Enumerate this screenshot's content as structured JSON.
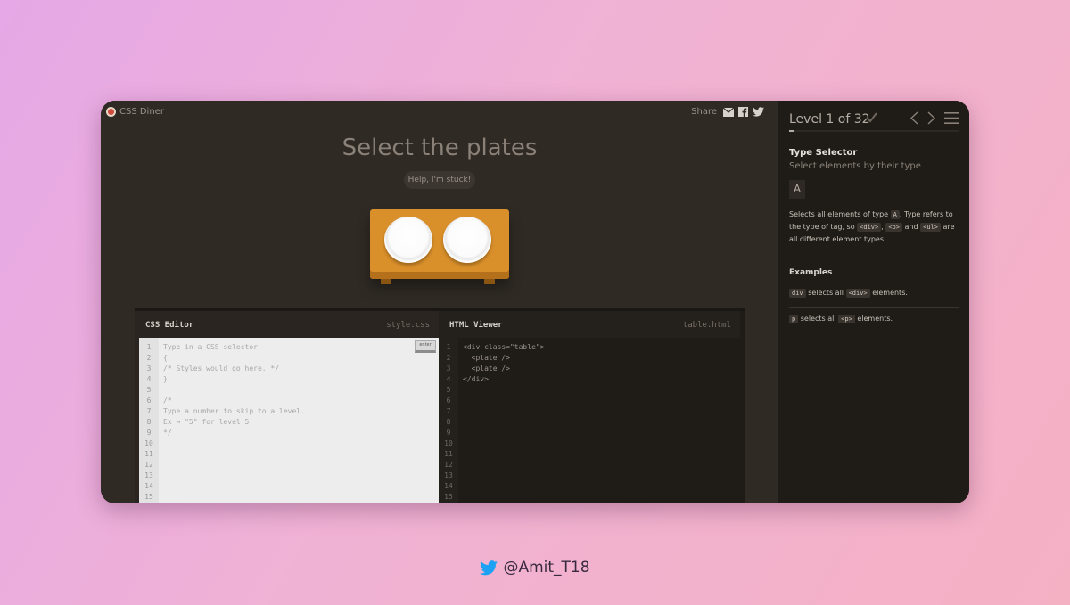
{
  "app": {
    "title": "CSS Diner"
  },
  "share": {
    "label": "Share"
  },
  "level": {
    "heading": "Select the plates",
    "help_label": "Help, I'm stuck!",
    "indicator": "Level 1 of 32",
    "progress_fraction": 0.03
  },
  "css_editor": {
    "title": "CSS Editor",
    "filename": "style.css",
    "enter_label": "enter",
    "lines": [
      "Type in a CSS selector",
      "{",
      "/* Styles would go here. */",
      "}",
      "",
      "/*",
      "Type a number to skip to a level.",
      "Ex → \"5\" for level 5",
      "*/",
      "",
      "",
      "",
      "",
      "",
      ""
    ],
    "line_numbers": [
      "1",
      "2",
      "3",
      "4",
      "5",
      "6",
      "7",
      "8",
      "9",
      "10",
      "11",
      "12",
      "13",
      "14",
      "15"
    ]
  },
  "html_viewer": {
    "title": "HTML Viewer",
    "filename": "table.html",
    "lines": [
      "<div class=\"table\">",
      "  <plate />",
      "  <plate />",
      "</div>",
      "",
      "",
      "",
      "",
      "",
      "",
      "",
      "",
      "",
      "",
      ""
    ],
    "line_numbers": [
      "1",
      "2",
      "3",
      "4",
      "5",
      "6",
      "7",
      "8",
      "9",
      "10",
      "11",
      "12",
      "13",
      "14",
      "15"
    ]
  },
  "sidebar": {
    "selector_name": "Type Selector",
    "selector_subtitle": "Select elements by their type",
    "syntax": "A",
    "description": {
      "p1": "Selects all elements of type",
      "tag_a": "A",
      "p2": ". Type refers to the type of tag, so",
      "tag_div": "<div>",
      "comma": ",",
      "tag_p": "<p>",
      "and": "and",
      "tag_ul": "<ul>",
      "p3": "are all different element types."
    },
    "examples_heading": "Examples",
    "examples": [
      {
        "code": "div",
        "text1": "selects all",
        "tag": "<div>",
        "text2": "elements."
      },
      {
        "code": "p",
        "text1": "selects all",
        "tag": "<p>",
        "text2": "elements."
      }
    ]
  },
  "footer": {
    "handle": "@Amit_T18"
  },
  "colors": {
    "accent": "#d98f2a",
    "twitter": "#1da1f2",
    "sidebar_bg": "#1f1c18"
  }
}
